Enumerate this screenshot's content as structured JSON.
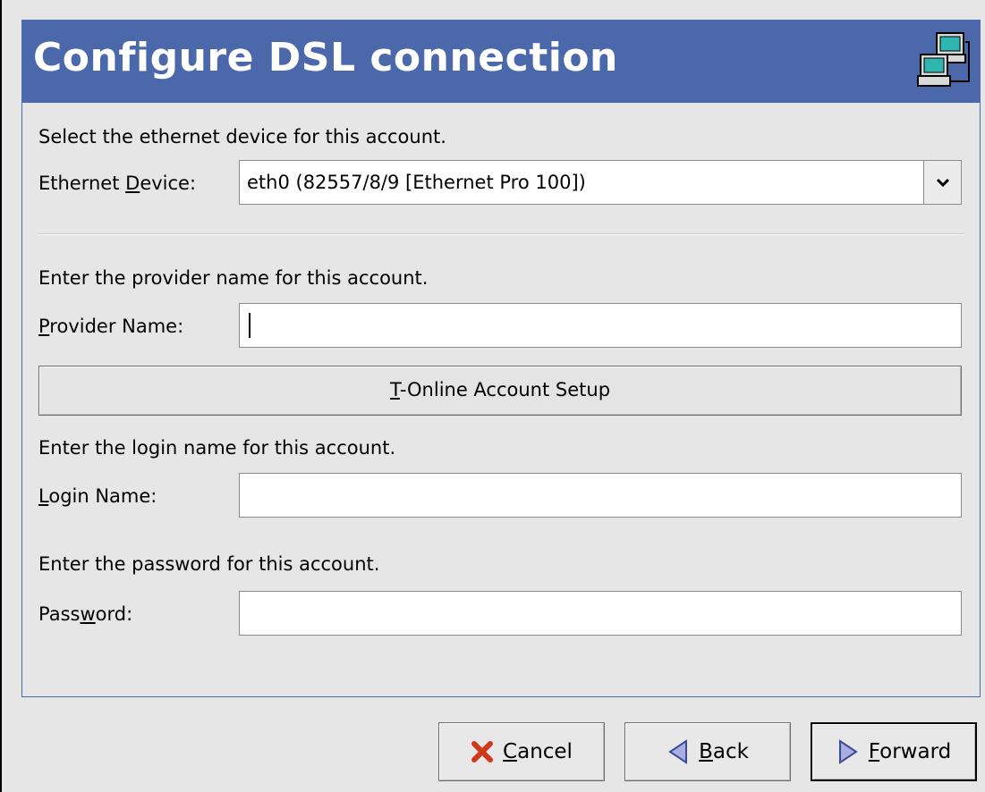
{
  "header": {
    "title": "Configure DSL connection",
    "icon": "network-computers-icon"
  },
  "ethernet": {
    "instruction": "Select the ethernet device for this account.",
    "label_pre": "Ethernet ",
    "label_mnemonic": "D",
    "label_post": "evice:",
    "selected_value": "eth0 (82557/8/9 [Ethernet Pro 100])"
  },
  "provider": {
    "instruction": "Enter the provider name for this account.",
    "label_mnemonic": "P",
    "label_post": "rovider Name:",
    "value": ""
  },
  "tonline_button": {
    "mnemonic": "T",
    "label_post": "-Online Account Setup"
  },
  "login": {
    "instruction": "Enter the login name for this account.",
    "label_mnemonic": "L",
    "label_post": "ogin Name:",
    "value": ""
  },
  "password": {
    "instruction": "Enter the password for this account.",
    "label_pre": "Pass",
    "label_mnemonic": "w",
    "label_post": "ord:",
    "value": ""
  },
  "buttons": {
    "cancel": {
      "mnemonic": "C",
      "label_post": "ancel",
      "icon": "cancel-x-icon"
    },
    "back": {
      "mnemonic": "B",
      "label_post": "ack",
      "icon": "arrow-left-icon"
    },
    "forward": {
      "mnemonic": "F",
      "label_post": "orward",
      "icon": "arrow-right-icon"
    }
  },
  "colors": {
    "header_bg": "#4b68aa",
    "header_text": "#ffffff",
    "cancel_icon": "#d03a1a",
    "arrow_icon": "#5a64b8"
  }
}
